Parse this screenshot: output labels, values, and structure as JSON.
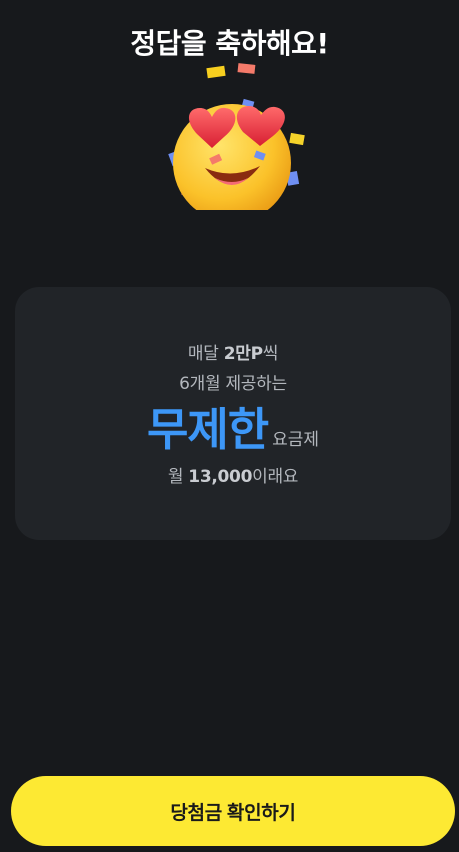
{
  "header": {
    "title": "정답을 축하해요!"
  },
  "illustration": {
    "icon": "heart-eyes-face-icon"
  },
  "card": {
    "line1_prefix": "매달 ",
    "line1_bold": "2만P",
    "line1_suffix": "씩",
    "line2": "6개월 제공하는",
    "headline": "무제한",
    "headline_suffix": "요금제",
    "line4_prefix": "월 ",
    "line4_bold": "13,000",
    "line4_suffix": "이래요"
  },
  "cta": {
    "label": "당첨금 확인하기"
  },
  "colors": {
    "background": "#17191c",
    "card": "#212428",
    "accent": "#3d97f7",
    "button": "#fde933"
  }
}
